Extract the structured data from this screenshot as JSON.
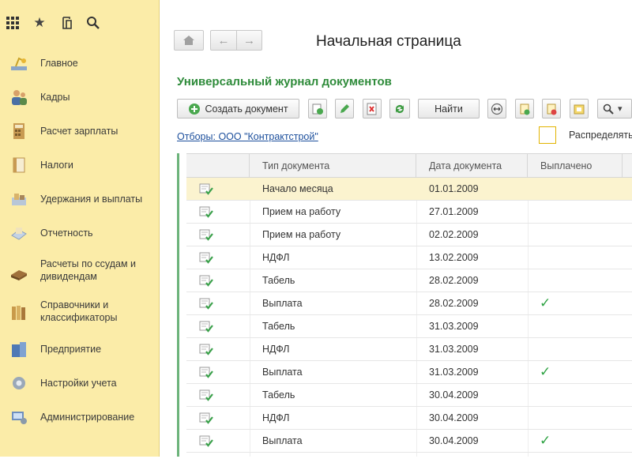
{
  "sidebar": {
    "top_icons": [
      "grid-icon",
      "star-icon",
      "history-icon",
      "search-icon"
    ],
    "items": [
      {
        "label": "Главное",
        "icon": "desk-lamp-icon"
      },
      {
        "label": "Кадры",
        "icon": "people-icon"
      },
      {
        "label": "Расчет зарплаты",
        "icon": "calculator-icon"
      },
      {
        "label": "Налоги",
        "icon": "tax-document-icon"
      },
      {
        "label": "Удержания и выплаты",
        "icon": "payments-icon"
      },
      {
        "label": "Отчетность",
        "icon": "report-icon"
      },
      {
        "label": "Расчеты по ссудам и дивидендам",
        "icon": "loans-icon"
      },
      {
        "label": "Справочники и классификаторы",
        "icon": "books-icon"
      },
      {
        "label": "Предприятие",
        "icon": "building-icon"
      },
      {
        "label": "Настройки учета",
        "icon": "settings-icon"
      },
      {
        "label": "Администрирование",
        "icon": "admin-icon"
      }
    ]
  },
  "header": {
    "page_title": "Начальная страница",
    "journal_title": "Универсальный журнал документов"
  },
  "toolbar": {
    "create_label": "Создать документ",
    "find_label": "Найти",
    "search_dropdown_glyph": "▾"
  },
  "filter": {
    "link_text": "Отборы: ООО \"Контрактстрой\"",
    "distribute_label": "Распределять",
    "distribute_checked": false
  },
  "table": {
    "columns": [
      "Тип документа",
      "Дата документа",
      "Выплачено"
    ],
    "rows": [
      {
        "type": "Начало месяца",
        "date": "01.01.2009",
        "paid": false,
        "selected": true
      },
      {
        "type": "Прием на работу",
        "date": "27.01.2009",
        "paid": false,
        "selected": false
      },
      {
        "type": "Прием на работу",
        "date": "02.02.2009",
        "paid": false,
        "selected": false
      },
      {
        "type": "НДФЛ",
        "date": "13.02.2009",
        "paid": false,
        "selected": false
      },
      {
        "type": "Табель",
        "date": "28.02.2009",
        "paid": false,
        "selected": false
      },
      {
        "type": "Выплата",
        "date": "28.02.2009",
        "paid": true,
        "selected": false
      },
      {
        "type": "Табель",
        "date": "31.03.2009",
        "paid": false,
        "selected": false
      },
      {
        "type": "НДФЛ",
        "date": "31.03.2009",
        "paid": false,
        "selected": false
      },
      {
        "type": "Выплата",
        "date": "31.03.2009",
        "paid": true,
        "selected": false
      },
      {
        "type": "Табель",
        "date": "30.04.2009",
        "paid": false,
        "selected": false
      },
      {
        "type": "НДФЛ",
        "date": "30.04.2009",
        "paid": false,
        "selected": false
      },
      {
        "type": "Выплата",
        "date": "30.04.2009",
        "paid": true,
        "selected": false
      }
    ]
  },
  "colors": {
    "sidebar_bg": "#fbeca8",
    "accent_green": "#2e8b3a",
    "link_blue": "#1c4f9c",
    "check_green": "#2fa344",
    "selected_row": "#fbf3cf"
  }
}
